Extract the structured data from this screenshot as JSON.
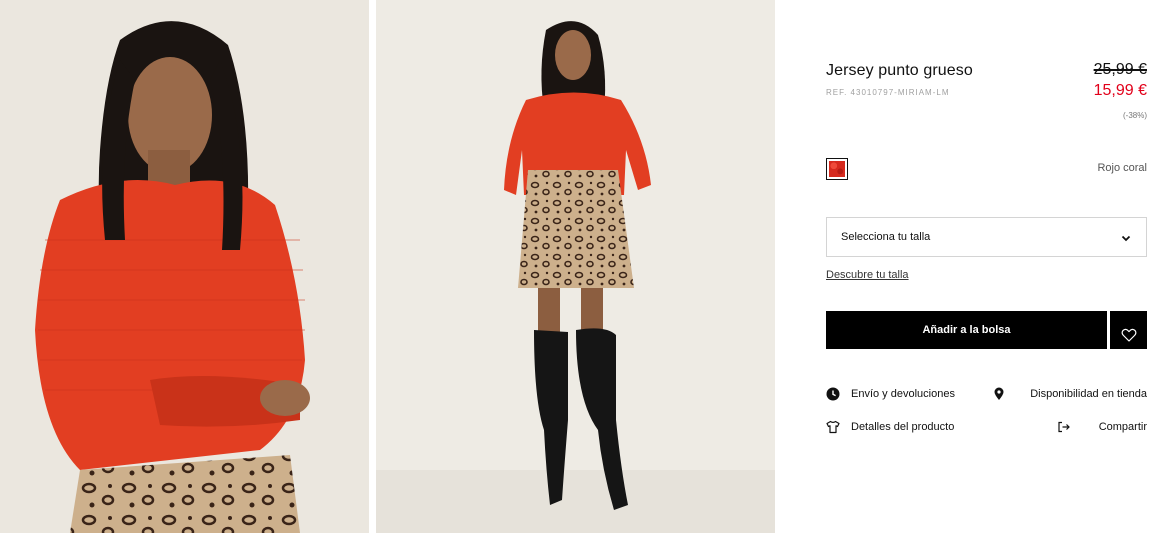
{
  "product": {
    "title": "Jersey punto grueso",
    "reference": "REF. 43010797-MIRIAM-LM",
    "price_original": "25,99 €",
    "price_sale": "15,99 €",
    "discount": "(-38%)",
    "color_name": "Rojo coral"
  },
  "size_selector": {
    "placeholder": "Selecciona tu talla",
    "size_guide_link": "Descubre tu talla"
  },
  "actions": {
    "add_to_bag": "Añadir a la bolsa",
    "wishlist_icon": "heart-icon"
  },
  "links": {
    "shipping": "Envío y devoluciones",
    "shipping_icon": "clock-icon",
    "store_availability": "Disponibilidad en tienda",
    "store_availability_icon": "location-pin-icon",
    "product_details": "Detalles del producto",
    "product_details_icon": "tshirt-icon",
    "share": "Compartir",
    "share_icon": "share-icon"
  },
  "colors": {
    "accent_sale": "#e2001a",
    "button_bg": "#000000",
    "swatch": "#d62a1e"
  }
}
